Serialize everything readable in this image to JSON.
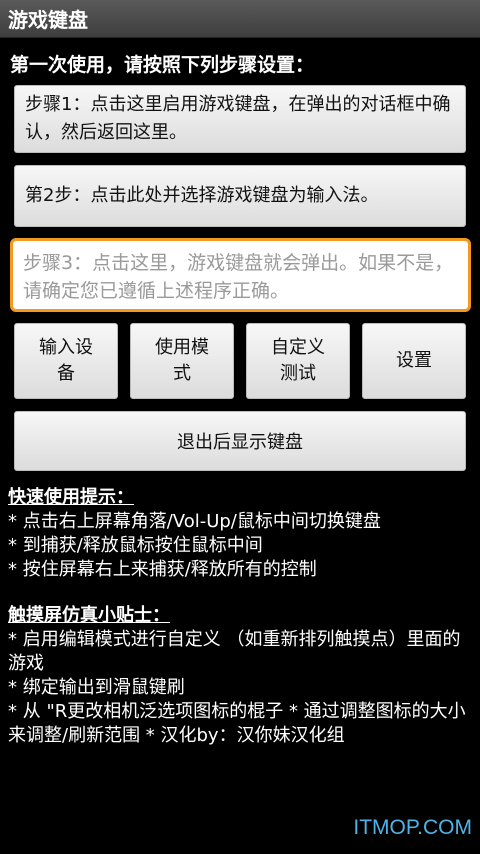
{
  "app": {
    "title": "游戏键盘"
  },
  "intro": "第一次使用，请按照下列步骤设置：",
  "steps": {
    "step1": "步骤1：点击这里启用游戏键盘，在弹出的对话框中确认，然后返回这里。",
    "step2": "第2步：点击此处并选择游戏键盘为输入法。",
    "step3": "步骤3：点击这里，游戏键盘就会弹出。如果不是，请确定您已遵循上述程序正确。"
  },
  "buttons": {
    "input_device_l1": "输入设",
    "input_device_l2": "备",
    "use_mode_l1": "使用模",
    "use_mode_l2": "式",
    "custom_test_l1": "自定义",
    "custom_test_l2": "测试",
    "settings": "设置",
    "exit_show_keyboard": "退出后显示键盘"
  },
  "quick_tips": {
    "header": "快速使用提示：",
    "items": [
      "* 点击右上屏幕角落/Vol-Up/鼠标中间切换键盘",
      "* 到捕获/释放鼠标按住鼠标中间",
      "* 按住屏幕右上来捕获/释放所有的控制"
    ]
  },
  "touch_tips": {
    "header": "触摸屏仿真小贴士：",
    "items": [
      "* 启用编辑模式进行自定义 （如重新排列触摸点）里面的游戏",
      "* 绑定输出到滑鼠键刷",
      "* 从 \"R更改相机泛选项图标的棍子 * 通过调整图标的大小来调整/刷新范围 * 汉化by：汉你妹汉化组"
    ]
  },
  "watermark": "ITMOP.COM",
  "colors": {
    "focus_border": "#f39a1e",
    "watermark": "#4fb3e8"
  }
}
